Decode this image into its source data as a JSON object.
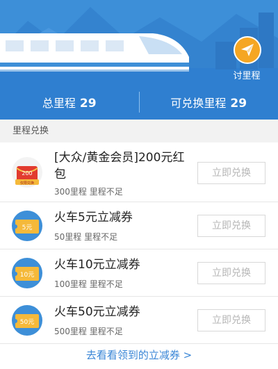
{
  "header": {
    "ask_label": "讨里程",
    "total_label": "总里程",
    "total_value": "29",
    "redeemable_label": "可兑换里程",
    "redeemable_value": "29"
  },
  "section_title": "里程兑换",
  "items": [
    {
      "title": "[大众/黄金会员]200元红包",
      "sub": "300里程 里程不足",
      "button": "立即兑换",
      "icon": "red-envelope-icon",
      "badge": "200",
      "ribbon": "仅限兑换"
    },
    {
      "title": "火车5元立减券",
      "sub": "50里程 里程不足",
      "button": "立即兑换",
      "icon": "coupon-icon",
      "badge": "5元"
    },
    {
      "title": "火车10元立减券",
      "sub": "100里程 里程不足",
      "button": "立即兑换",
      "icon": "coupon-icon",
      "badge": "10元"
    },
    {
      "title": "火车50元立减券",
      "sub": "500里程 里程不足",
      "button": "立即兑换",
      "icon": "coupon-icon",
      "badge": "50元"
    }
  ],
  "footer_link": "去看看领到的立减券 >",
  "colors": {
    "header_blue": "#3d8fd8",
    "stats_blue": "#2f7fd0",
    "accent_orange": "#f5a623",
    "link_blue": "#3a86d6"
  }
}
